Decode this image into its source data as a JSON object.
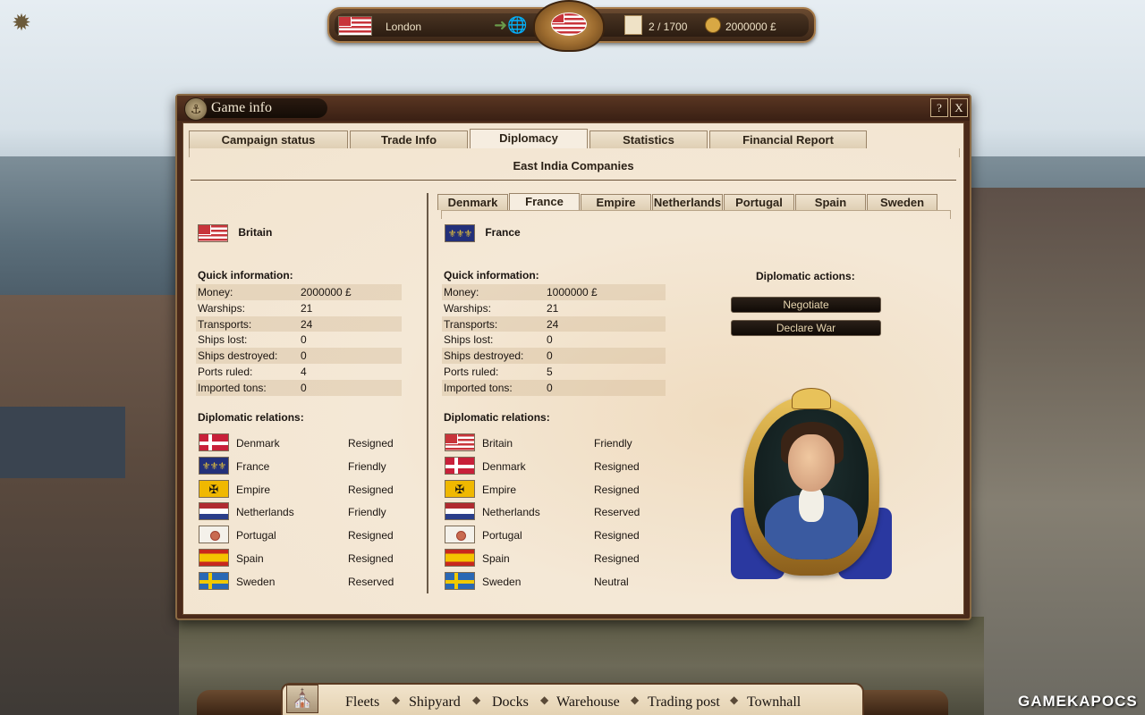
{
  "hud": {
    "city": "London",
    "pages": "2 / 1700",
    "money": "2000000 £"
  },
  "window": {
    "title": "Game info",
    "help_label": "?",
    "close_label": "X",
    "tabs": [
      "Campaign status",
      "Trade Info",
      "Diplomacy",
      "Statistics",
      "Financial Report"
    ],
    "active_tab": "Diplomacy",
    "heading": "East India Companies"
  },
  "left": {
    "country": "Britain",
    "quick_label": "Quick information:",
    "rows": [
      {
        "k": "Money:",
        "v": "2000000 £"
      },
      {
        "k": "Warships:",
        "v": "21"
      },
      {
        "k": "Transports:",
        "v": "24"
      },
      {
        "k": "Ships lost:",
        "v": "0"
      },
      {
        "k": "Ships destroyed:",
        "v": "0"
      },
      {
        "k": "Ports ruled:",
        "v": "4"
      },
      {
        "k": "Imported tons:",
        "v": "0"
      }
    ],
    "relations_label": "Diplomatic relations:",
    "relations": [
      {
        "n": "Denmark",
        "s": "Resigned"
      },
      {
        "n": "France",
        "s": "Friendly"
      },
      {
        "n": "Empire",
        "s": "Resigned"
      },
      {
        "n": "Netherlands",
        "s": "Friendly"
      },
      {
        "n": "Portugal",
        "s": "Resigned"
      },
      {
        "n": "Spain",
        "s": "Resigned"
      },
      {
        "n": "Sweden",
        "s": "Reserved"
      }
    ]
  },
  "right": {
    "subtabs": [
      "Denmark",
      "France",
      "Empire",
      "Netherlands",
      "Portugal",
      "Spain",
      "Sweden"
    ],
    "active_subtab": "France",
    "country": "France",
    "quick_label": "Quick information:",
    "rows": [
      {
        "k": "Money:",
        "v": "1000000 £"
      },
      {
        "k": "Warships:",
        "v": "21"
      },
      {
        "k": "Transports:",
        "v": "24"
      },
      {
        "k": "Ships lost:",
        "v": "0"
      },
      {
        "k": "Ships destroyed:",
        "v": "0"
      },
      {
        "k": "Ports ruled:",
        "v": "5"
      },
      {
        "k": "Imported tons:",
        "v": "0"
      }
    ],
    "relations_label": "Diplomatic relations:",
    "relations": [
      {
        "n": "Britain",
        "s": "Friendly"
      },
      {
        "n": "Denmark",
        "s": "Resigned"
      },
      {
        "n": "Empire",
        "s": "Resigned"
      },
      {
        "n": "Netherlands",
        "s": "Reserved"
      },
      {
        "n": "Portugal",
        "s": "Resigned"
      },
      {
        "n": "Spain",
        "s": "Resigned"
      },
      {
        "n": "Sweden",
        "s": "Neutral"
      }
    ],
    "actions_label": "Diplomatic actions:",
    "negotiate_label": "Negotiate",
    "declare_war_label": "Declare War"
  },
  "bottom_nav": [
    "Fleets",
    "Shipyard",
    "Docks",
    "Warehouse",
    "Trading post",
    "Townhall"
  ],
  "watermark": "GAMEKAPOCS"
}
